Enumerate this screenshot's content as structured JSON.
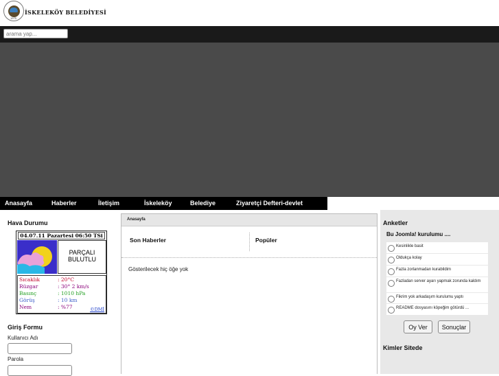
{
  "header": {
    "logo_year": "1975",
    "site_title": "İSKELEKÖY BELEDİYESİ"
  },
  "search": {
    "placeholder": "arama yap..."
  },
  "nav": {
    "items": [
      {
        "label": "Anasayfa"
      },
      {
        "label": "Haberler"
      },
      {
        "label": "İletişim"
      },
      {
        "label": "İskeleköy"
      },
      {
        "label": "Belediye"
      },
      {
        "label": "Ziyaretçi Defteri-devlet"
      }
    ]
  },
  "weather": {
    "title": "Hava Durumu",
    "date": "04.07.11 Pazartesi 06:50 TSi",
    "condition_line1": "PARÇALI",
    "condition_line2": "BULUTLU",
    "rows": [
      {
        "label": "Sıcaklık",
        "value": ": 20°C",
        "color": "#c0002a"
      },
      {
        "label": "Rüzgar",
        "value": ": 30° 2 km/s",
        "color": "#8a007a"
      },
      {
        "label": "Basınç",
        "value": ": 1010 hPa",
        "color": "#1f9e1f"
      },
      {
        "label": "Görüş",
        "value": ": 10 km",
        "color": "#3a5cc8"
      },
      {
        "label": "Nem",
        "value": ": %77",
        "color": "#8a007a"
      }
    ],
    "credit": "©DMİ"
  },
  "login": {
    "title": "Giriş Formu",
    "username_label": "Kullanıcı Adı",
    "password_label": "Parola"
  },
  "content": {
    "breadcrumb": "Anasayfa",
    "tab_latest": "Son Haberler",
    "tab_popular": "Popüler",
    "empty_message": "Gösterilecek hiç öğe yok"
  },
  "polls": {
    "title": "Anketler",
    "question": "Bu Joomla! kurulumu ....",
    "options": [
      {
        "label": "Kesinlikle basit"
      },
      {
        "label": "Oldukça kolay"
      },
      {
        "label": "Fazla zorlanmadan kurabildim"
      },
      {
        "label": "Fazladan server ayarı yapmak zorunda kaldım"
      },
      {
        "label": "Fikrim yok arkadaşım kurulumu yaptı"
      },
      {
        "label": "README dosyasını köpeğim götürdü ..."
      }
    ],
    "vote_label": "Oy Ver",
    "results_label": "Sonuçlar"
  },
  "whos_online": {
    "title": "Kimler Sitede"
  }
}
